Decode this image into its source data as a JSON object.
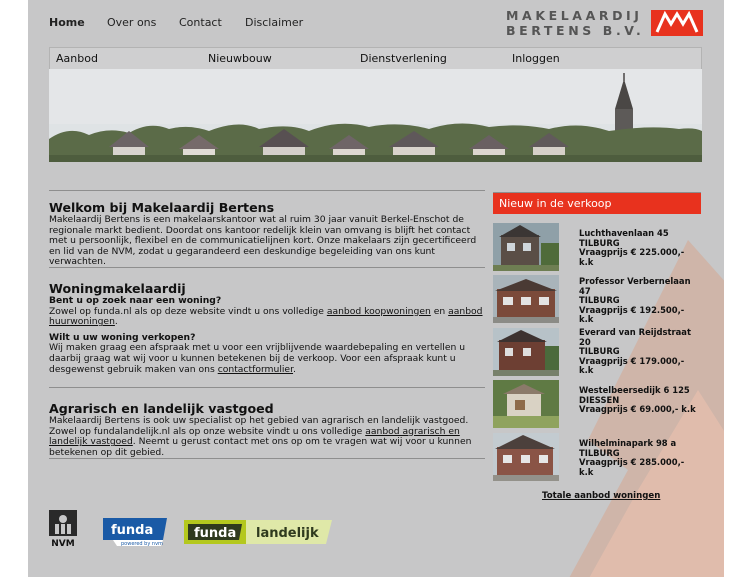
{
  "topnav": [
    {
      "label": "Home",
      "active": true
    },
    {
      "label": "Over ons"
    },
    {
      "label": "Contact"
    },
    {
      "label": "Disclaimer"
    }
  ],
  "brand": {
    "line1": "MAKELAARDIJ",
    "line2": "BERTENS B.V."
  },
  "menu": [
    "Aanbod",
    "Nieuwbouw",
    "Dienstverlening",
    "Inloggen"
  ],
  "sections": {
    "welkom": {
      "title": "Welkom bij Makelaardij Bertens",
      "body": "Makelaardij Bertens is een makelaarskantoor wat al ruim 30 jaar vanuit Berkel-Enschot de regionale markt bedient. Doordat ons kantoor redelijk klein van omvang is blijft het contact met u persoonlijk, flexibel en de communicatielijnen kort. Onze makelaars zijn gecertificeerd en lid van de NVM, zodat u gegarandeerd een deskundige begeleiding van ons kunt verwachten."
    },
    "woning": {
      "title": "Woningmakelaardij",
      "q1": "Bent u op zoek naar een woning?",
      "p1_a": "Zowel op funda.nl als op deze website vindt u ons volledige ",
      "p1_link1": "aanbod koopwoningen",
      "p1_b": " en ",
      "p1_link2": "aanbod huurwoningen",
      "p1_c": ".",
      "q2": "Wilt u uw woning verkopen?",
      "p2_a": "Wij maken graag een afspraak met u voor een vrijblijvende waardebepaling en vertellen u daarbij graag wat wij voor u kunnen betekenen bij de verkoop. Voor een afspraak kunt u desgewenst gebruik maken van ons ",
      "p2_link": "contactformulier",
      "p2_b": "."
    },
    "agrarisch": {
      "title": "Agrarisch en landelijk vastgoed",
      "p_a": "Makelaardij Bertens is ook uw specialist op het gebied van agrarisch en landelijk vastgoed. Zowel op fundalandelijk.nl als op onze website vindt u ons volledige ",
      "p_link": "aanbod agrarisch en landelijk vastgoed",
      "p_b": ". Neemt u gerust contact met ons op om te vragen wat wij voor u kunnen betekenen op dit gebied."
    }
  },
  "sidebar": {
    "title": "Nieuw in de verkoop",
    "listings": [
      {
        "street": "Luchthavenlaan 45",
        "city": "TILBURG",
        "price": "Vraagprijs € 225.000,- k.k"
      },
      {
        "street": "Professor Verbernelaan 47",
        "city": "TILBURG",
        "price": "Vraagprijs € 192.500,- k.k"
      },
      {
        "street": "Everard van Reijdstraat 20",
        "city": "TILBURG",
        "price": "Vraagprijs € 179.000,- k.k"
      },
      {
        "street": "Westelbeersedijk 6 125",
        "city": "DIESSEN",
        "price": "Vraagprijs € 69.000,- k.k"
      },
      {
        "street": "Wilhelminapark 98 a",
        "city": "TILBURG",
        "price": "Vraagprijs € 285.000,- k.k"
      }
    ],
    "total_link": "Totale aanbod woningen"
  },
  "logos": {
    "nvm": "NVM",
    "funda": "funda",
    "funda_sub": "powered by nvm",
    "funda_l1": "funda",
    "funda_l2": "landelijk"
  },
  "colors": {
    "accent": "#e8321e",
    "page_bg": "#c7c7c8",
    "funda_blue": "#1a5aa6",
    "funda_green": "#b4c81e"
  }
}
